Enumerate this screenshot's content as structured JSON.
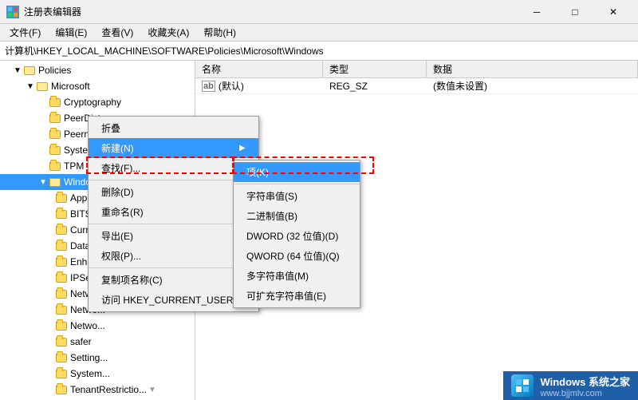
{
  "titleBar": {
    "title": "注册表编辑器",
    "minBtn": "─",
    "maxBtn": "□",
    "closeBtn": "✕"
  },
  "menuBar": {
    "items": [
      {
        "label": "文件(F)"
      },
      {
        "label": "编辑(E)"
      },
      {
        "label": "查看(V)"
      },
      {
        "label": "收藏夹(A)"
      },
      {
        "label": "帮助(H)"
      }
    ]
  },
  "addressBar": {
    "path": "计算机\\HKEY_LOCAL_MACHINE\\SOFTWARE\\Policies\\Microsoft\\Windows"
  },
  "tree": {
    "items": [
      {
        "label": "Policies",
        "indent": 1,
        "expanded": true,
        "type": "folder-open"
      },
      {
        "label": "Microsoft",
        "indent": 2,
        "expanded": true,
        "type": "folder-open"
      },
      {
        "label": "Cryptography",
        "indent": 3,
        "type": "folder"
      },
      {
        "label": "PeerDist",
        "indent": 3,
        "type": "folder"
      },
      {
        "label": "Peernet",
        "indent": 3,
        "type": "folder"
      },
      {
        "label": "SystemCertificates",
        "indent": 3,
        "type": "folder"
      },
      {
        "label": "TPM",
        "indent": 3,
        "type": "folder"
      },
      {
        "label": "Windows",
        "indent": 3,
        "type": "folder-open",
        "selected": true
      },
      {
        "label": "Appx",
        "indent": 4,
        "type": "folder"
      },
      {
        "label": "BITS",
        "indent": 4,
        "type": "folder"
      },
      {
        "label": "Curren...",
        "indent": 4,
        "type": "folder"
      },
      {
        "label": "DataC...",
        "indent": 4,
        "type": "folder"
      },
      {
        "label": "Enhanc...",
        "indent": 4,
        "type": "folder"
      },
      {
        "label": "IPSec",
        "indent": 4,
        "type": "folder"
      },
      {
        "label": "Netwo...",
        "indent": 4,
        "type": "folder"
      },
      {
        "label": "Netwo...",
        "indent": 4,
        "type": "folder"
      },
      {
        "label": "Netwo...",
        "indent": 4,
        "type": "folder"
      },
      {
        "label": "safer",
        "indent": 4,
        "type": "folder"
      },
      {
        "label": "Setting...",
        "indent": 4,
        "type": "folder"
      },
      {
        "label": "System...",
        "indent": 4,
        "type": "folder"
      },
      {
        "label": "TenantRestrictio...",
        "indent": 4,
        "type": "folder"
      }
    ]
  },
  "rightPanel": {
    "columns": [
      "名称",
      "类型",
      "数据"
    ],
    "rows": [
      {
        "name": "(默认)",
        "namePrefix": "ab",
        "type": "REG_SZ",
        "data": "(数值未设置)"
      }
    ]
  },
  "contextMenu": {
    "items": [
      {
        "label": "折叠",
        "type": "item"
      },
      {
        "label": "新建(N)",
        "type": "item",
        "hasSubmenu": true,
        "highlighted": true
      },
      {
        "label": "查找(F)...",
        "type": "item"
      },
      {
        "separator": true
      },
      {
        "label": "删除(D)",
        "type": "item"
      },
      {
        "label": "重命名(R)",
        "type": "item"
      },
      {
        "separator": true
      },
      {
        "label": "导出(E)",
        "type": "item"
      },
      {
        "label": "权限(P)...",
        "type": "item"
      },
      {
        "separator": true
      },
      {
        "label": "复制项名称(C)",
        "type": "item"
      },
      {
        "label": "访问 HKEY_CURRENT_USER(T)",
        "type": "item"
      }
    ]
  },
  "subMenu": {
    "items": [
      {
        "label": "项(K)",
        "highlighted": true
      },
      {
        "separator": true
      },
      {
        "label": "字符串值(S)"
      },
      {
        "label": "二进制值(B)"
      },
      {
        "label": "DWORD (32 位值)(D)"
      },
      {
        "label": "QWORD (64 位值)(Q)"
      },
      {
        "label": "多字符串值(M)"
      },
      {
        "label": "可扩充字符串值(E)"
      }
    ]
  },
  "watermark": {
    "line1": "Windows 系统之家",
    "line2": "www.bjjmlv.com"
  }
}
